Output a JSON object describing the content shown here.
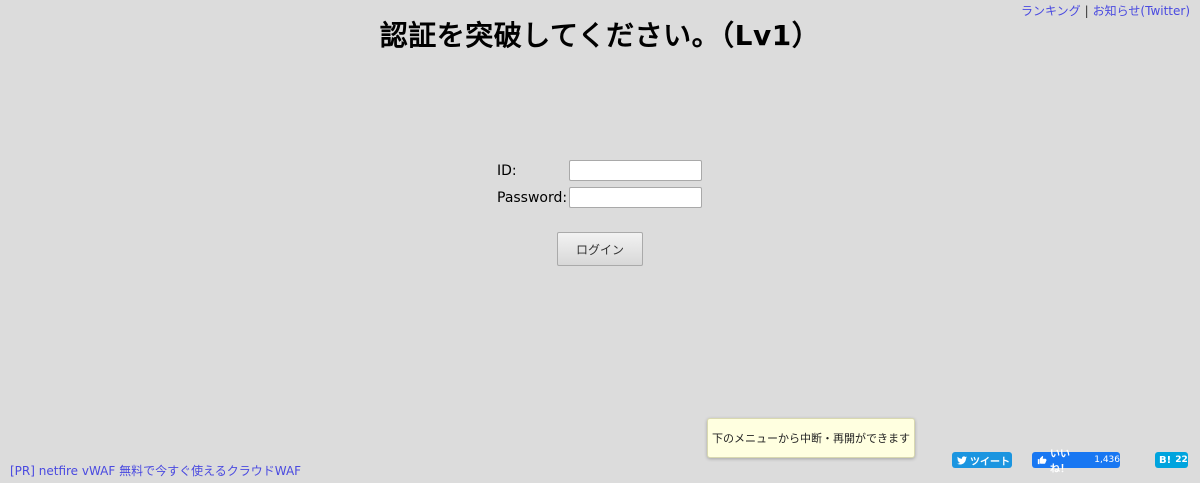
{
  "header": {
    "links": {
      "ranking": "ランキング",
      "separator": "|",
      "news": "お知らせ(Twitter)"
    },
    "title": "認証を突破してください。（Lv1）"
  },
  "form": {
    "id_label": "ID:",
    "id_value": "",
    "password_label": "Password:",
    "password_value": "",
    "login_button": "ログイン"
  },
  "tooltip": {
    "text": "下のメニューから中断・再開ができます"
  },
  "footer": {
    "pr_link": "[PR] netfire vWAF 無料で今すぐ使えるクラウドWAF",
    "share": {
      "tweet_label": "ツイート",
      "like_label": "いいね！",
      "like_count": "1,436",
      "hatena_label": "B!",
      "hatena_count": "22"
    }
  },
  "icons": {
    "twitter": "twitter-bird-icon",
    "like": "thumbs-up-icon"
  },
  "colors": {
    "background": "#dcdcdc",
    "link": "#4a4ae0",
    "tweet": "#1b95e0",
    "facebook": "#1877f2",
    "hatena": "#00a4de",
    "tooltip_bg": "#ffffe0"
  }
}
